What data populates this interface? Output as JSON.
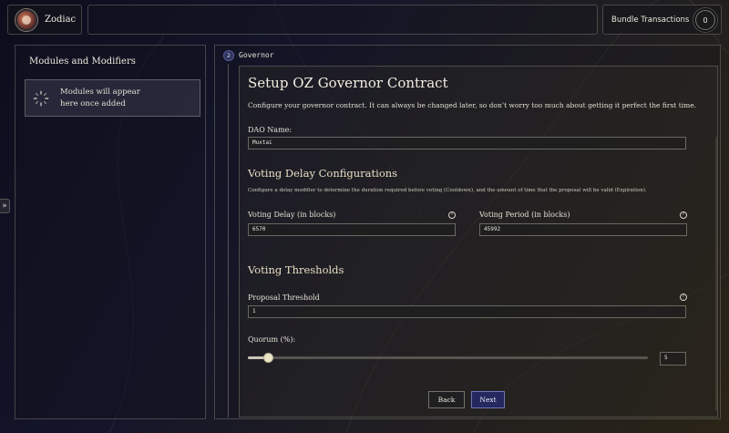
{
  "header": {
    "app_name": "Zodiac",
    "bundle_label": "Bundle Transactions",
    "bundle_count": "0"
  },
  "sidebar": {
    "title": "Modules and Modifiers",
    "empty_message": "Modules will appear here once added",
    "expand_icon": "»"
  },
  "step": {
    "number": "2",
    "label": "Governor"
  },
  "form": {
    "title": "Setup OZ Governor Contract",
    "description": "Configure your governor contract. It can always be changed later, so don’t worry too much about getting it perfect the first time.",
    "dao_name_label": "DAO Name:",
    "dao_name_value": "Muxtai",
    "voting_delay_section": "Voting Delay Configurations",
    "voting_delay_description": "Configure a delay modifier to determine the duration required before voting (Cooldown), and the amount of time that the proposal will be valid (Expiration).",
    "voting_delay_label": "Voting Delay (in blocks)",
    "voting_delay_value": "6570",
    "voting_period_label": "Voting Period (in blocks)",
    "voting_period_value": "45992",
    "thresholds_section": "Voting Thresholds",
    "proposal_threshold_label": "Proposal Threshold",
    "proposal_threshold_value": "1",
    "quorum_label": "Quorum (%):",
    "quorum_value": "5",
    "quorum_slider_fraction": 0.05,
    "help_icon": "?",
    "back_label": "Back",
    "next_label": "Next"
  },
  "colors": {
    "accent": "#24285e",
    "text": "#e4e2d6"
  }
}
